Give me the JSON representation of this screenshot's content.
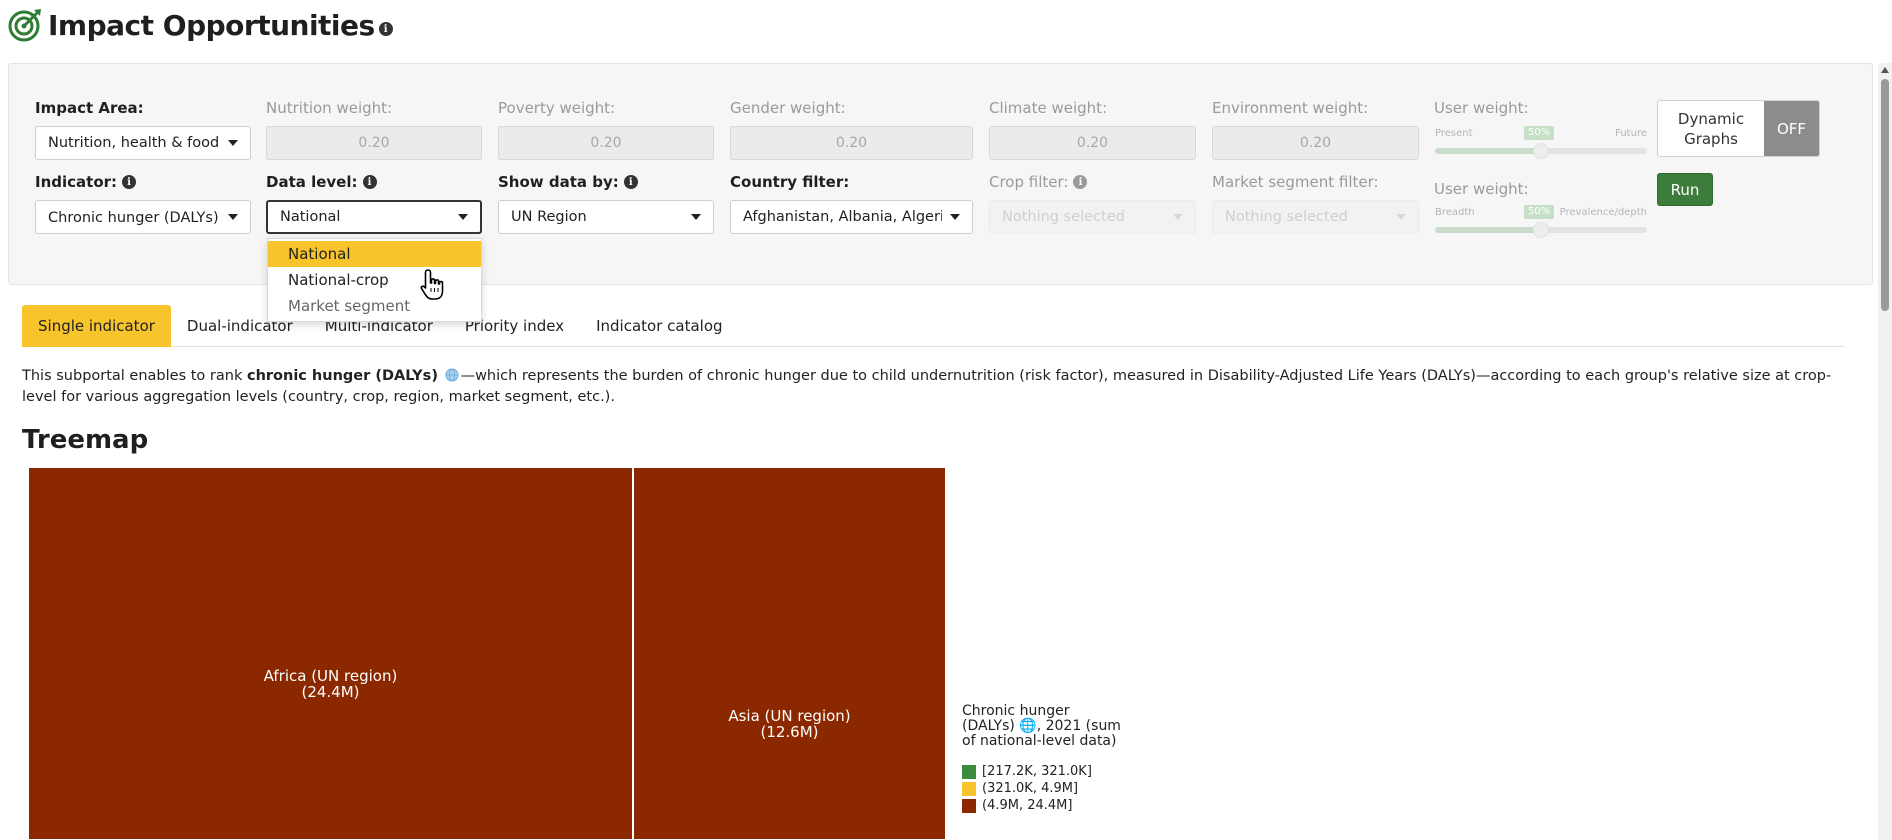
{
  "header": {
    "title": "Impact Opportunities",
    "info_glyph": "i"
  },
  "filters": {
    "impact_area": {
      "label": "Impact Area:",
      "value": "Nutrition, health & food se"
    },
    "nutrition_weight": {
      "label": "Nutrition weight:",
      "value": "0.20"
    },
    "poverty_weight": {
      "label": "Poverty weight:",
      "value": "0.20"
    },
    "gender_weight": {
      "label": "Gender weight:",
      "value": "0.20"
    },
    "climate_weight": {
      "label": "Climate weight:",
      "value": "0.20"
    },
    "environment_weight": {
      "label": "Environment weight:",
      "value": "0.20"
    },
    "user_weight_1": {
      "label": "User weight:",
      "left": "Present",
      "right": "Future",
      "badge": "50%",
      "level": 0.5
    },
    "user_weight_2": {
      "label": "User weight:",
      "left": "Breadth",
      "right": "Prevalence/depth",
      "badge": "50%",
      "level": 0.5
    },
    "indicator": {
      "label": "Indicator:",
      "value": "Chronic hunger (DALYs) 🌐"
    },
    "data_level": {
      "label": "Data level:",
      "value": "National"
    },
    "show_data_by": {
      "label": "Show data by:",
      "value": "UN Region"
    },
    "country_filter": {
      "label": "Country filter:",
      "value": "Afghanistan, Albania, Algeria,"
    },
    "crop_filter": {
      "label": "Crop filter:",
      "value": "Nothing selected"
    },
    "market_segment_filter": {
      "label": "Market segment filter:",
      "value": "Nothing selected"
    }
  },
  "dynamic_graphs": {
    "label": "Dynamic Graphs",
    "state": "OFF"
  },
  "run_label": "Run",
  "data_level_options": [
    "National",
    "National-crop",
    "Market segment"
  ],
  "tabs": [
    "Single indicator",
    "Dual-indicator",
    "Multi-indicator",
    "Priority index",
    "Indicator catalog"
  ],
  "description": {
    "before": "This subportal enables to rank ",
    "bold": "chronic hunger (DALYs)",
    "after": "—which represents the burden of chronic hunger due to child undernutrition (risk factor), measured in Disability-Adjusted Life Years (DALYs)—according to each group's relative size at crop-level for various aggregation levels (country, crop, region, market segment, etc.)."
  },
  "section_title": "Treemap",
  "chart_data": {
    "type": "treemap",
    "items": [
      {
        "label": "Africa (UN region)",
        "value_label": "(24.4M)",
        "value": 24.4
      },
      {
        "label": "Asia (UN region)",
        "value_label": "(12.6M)",
        "value": 12.6
      }
    ],
    "legend": {
      "title": "Chronic hunger (DALYs) 🌐, 2021 (sum of national-level data)",
      "items": [
        {
          "label": "[217.2K, 321.0K]",
          "color": "#3c8a3c"
        },
        {
          "label": "(321.0K, 4.9M]",
          "color": "#f8c42c"
        },
        {
          "label": "(4.9M, 24.4M]",
          "color": "#8b2800"
        }
      ]
    }
  },
  "colors": {
    "accent": "#f8c42c",
    "run": "#3c7d3c",
    "treemap_fill": "#8b2800",
    "logo": "#2e7d32"
  }
}
